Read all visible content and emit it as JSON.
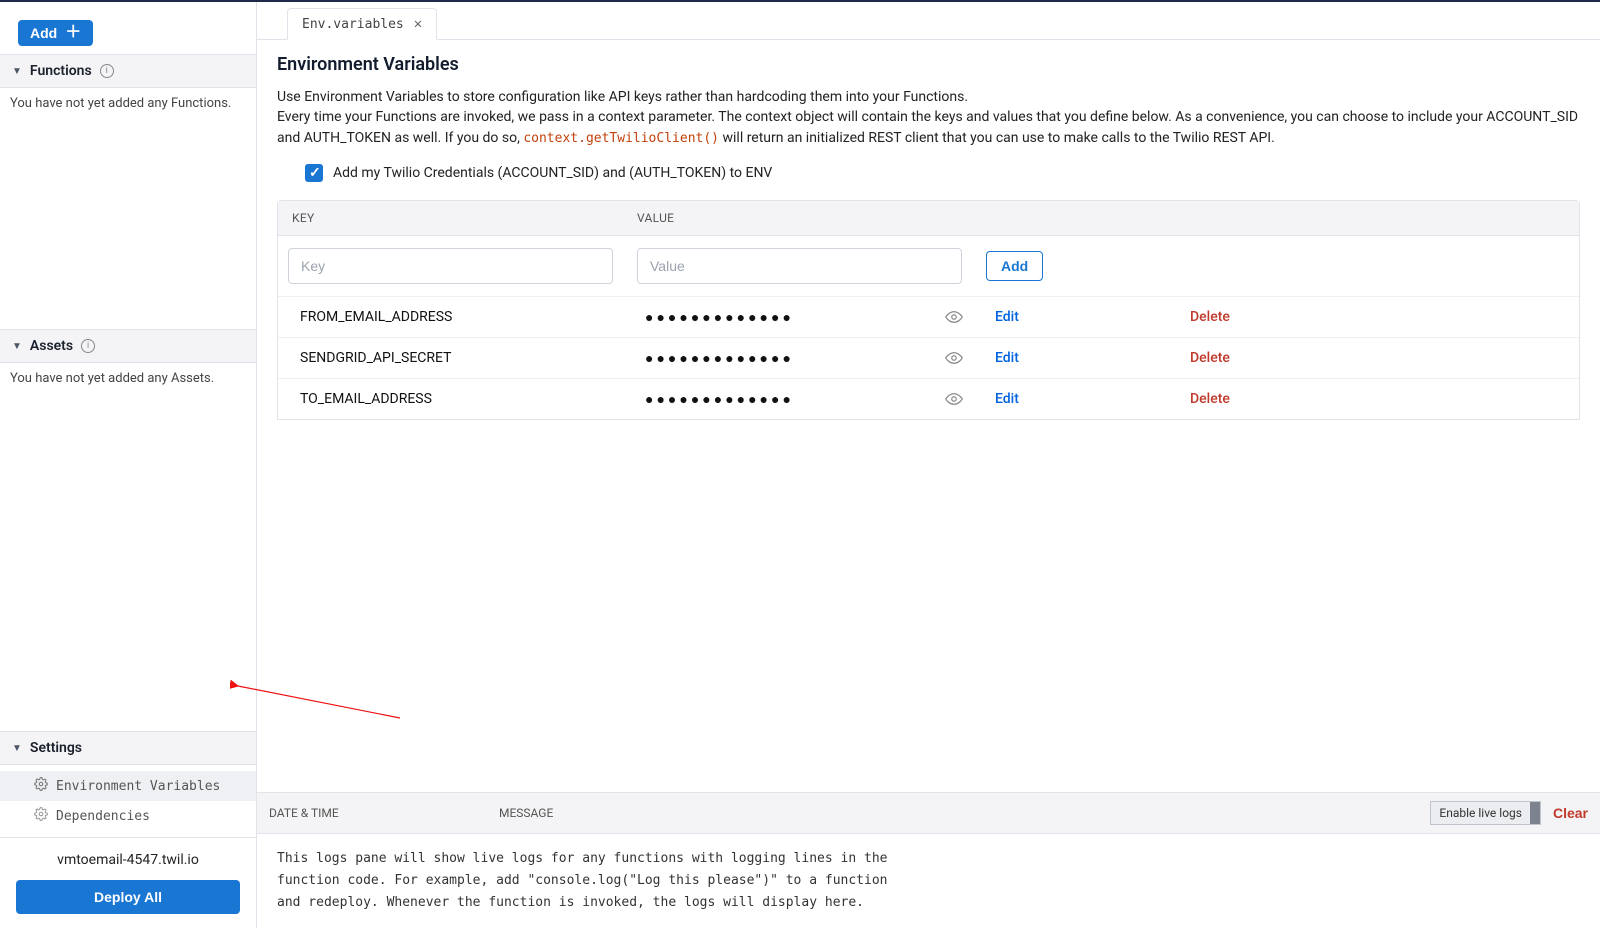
{
  "sidebar": {
    "add_label": "Add",
    "functions": {
      "title": "Functions",
      "empty": "You have not yet added any Functions."
    },
    "assets": {
      "title": "Assets",
      "empty": "You have not yet added any Assets."
    },
    "settings": {
      "title": "Settings",
      "items": [
        {
          "label": "Environment Variables",
          "active": true
        },
        {
          "label": "Dependencies",
          "active": false
        }
      ]
    },
    "domain": "vmtoemail-4547.twil.io",
    "deploy_label": "Deploy All"
  },
  "tabs": [
    {
      "label": "Env.variables"
    }
  ],
  "page": {
    "title": "Environment Variables",
    "desc_line1": "Use Environment Variables to store configuration like API keys rather than hardcoding them into your Functions.",
    "desc_line2_a": "Every time your Functions are invoked, we pass in a context parameter. The context object will contain the keys and values that you define below. As a convenience, you can choose to include your ACCOUNT_SID and AUTH_TOKEN as well. If you do so, ",
    "desc_code": "context.getTwilioClient()",
    "desc_line2_b": " will return an initialized REST client that you can use to make calls to the Twilio REST API.",
    "cred_label": "Add my Twilio Credentials (ACCOUNT_SID) and (AUTH_TOKEN) to ENV",
    "cred_checked": true,
    "columns": {
      "key": "KEY",
      "value": "VALUE"
    },
    "placeholders": {
      "key": "Key",
      "value": "Value"
    },
    "add_row_label": "Add",
    "edit_label": "Edit",
    "delete_label": "Delete",
    "rows": [
      {
        "key": "FROM_EMAIL_ADDRESS",
        "masked": "●●●●●●●●●●●●●"
      },
      {
        "key": "SENDGRID_API_SECRET",
        "masked": "●●●●●●●●●●●●●"
      },
      {
        "key": "TO_EMAIL_ADDRESS",
        "masked": "●●●●●●●●●●●●●"
      }
    ]
  },
  "logs": {
    "col_date": "DATE & TIME",
    "col_msg": "MESSAGE",
    "live_label": "Enable live logs",
    "clear_label": "Clear",
    "body": "This logs pane will show live logs for any functions with logging lines in the function code. For example, add \"console.log(\"Log this please\")\" to a function and redeploy. Whenever the function is invoked, the logs will display here."
  }
}
